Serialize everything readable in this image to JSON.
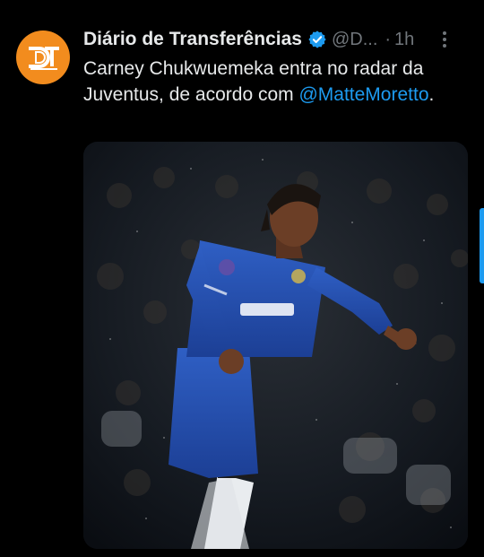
{
  "account": {
    "name": "Diário de Transferências",
    "handle": "@D...",
    "separator": "·",
    "time": "1h",
    "avatar_icon": "dt-logo-icon",
    "verified_icon": "verified-badge-icon"
  },
  "tweet": {
    "text_part1": "Carney Chukwuemeka entra no radar da Juventus, de acordo com ",
    "mention": "@MatteMoretto",
    "text_part2": "."
  },
  "media": {
    "description_icon": "football-player-photo"
  },
  "colors": {
    "background": "#000000",
    "text": "#e7e9ea",
    "secondary": "#71767b",
    "link": "#1d9bf0",
    "avatar": "#f28c1e"
  }
}
